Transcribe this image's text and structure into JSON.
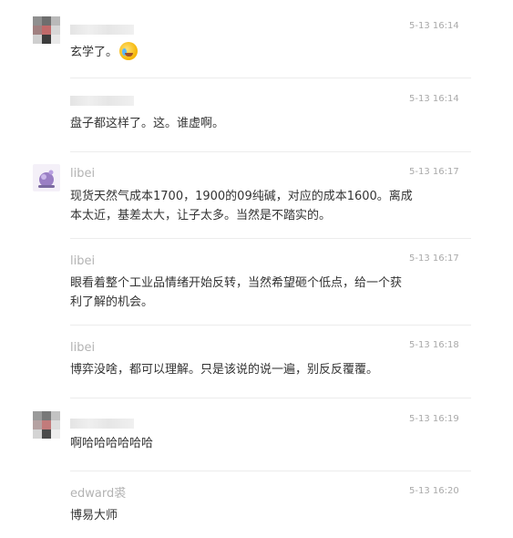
{
  "comments": [
    {
      "name": "",
      "time": "5-13 16:14",
      "text": "玄学了。",
      "emoji": "laughing-tears-emoji"
    },
    {
      "name": "",
      "time": "5-13 16:14",
      "text": "盘子都这样了。这。谁虚啊。"
    },
    {
      "name": "libei",
      "time": "5-13 16:17",
      "text_lines": [
        "现货天然气成本1700，1900的09纯碱，对应的成本1600。离成",
        "本太近，基差太大，让子太多。当然是不踏实的。"
      ]
    },
    {
      "name": "libei",
      "time": "5-13 16:17",
      "text_lines": [
        "眼看着整个工业品情绪开始反转，当然希望砸个低点，给一个获",
        "利了解的机会。"
      ]
    },
    {
      "name": "libei",
      "time": "5-13 16:18",
      "text": "博弈没啥，都可以理解。只是该说的说一遍，别反反覆覆。"
    },
    {
      "name": "",
      "time": "5-13 16:19",
      "text": "啊哈哈哈哈哈哈"
    },
    {
      "name": "edward裘",
      "time": "5-13 16:20",
      "text": "博易大师"
    }
  ],
  "colors": {
    "text": "#333333",
    "meta": "#a9a9a9",
    "separator": "#ececec"
  }
}
